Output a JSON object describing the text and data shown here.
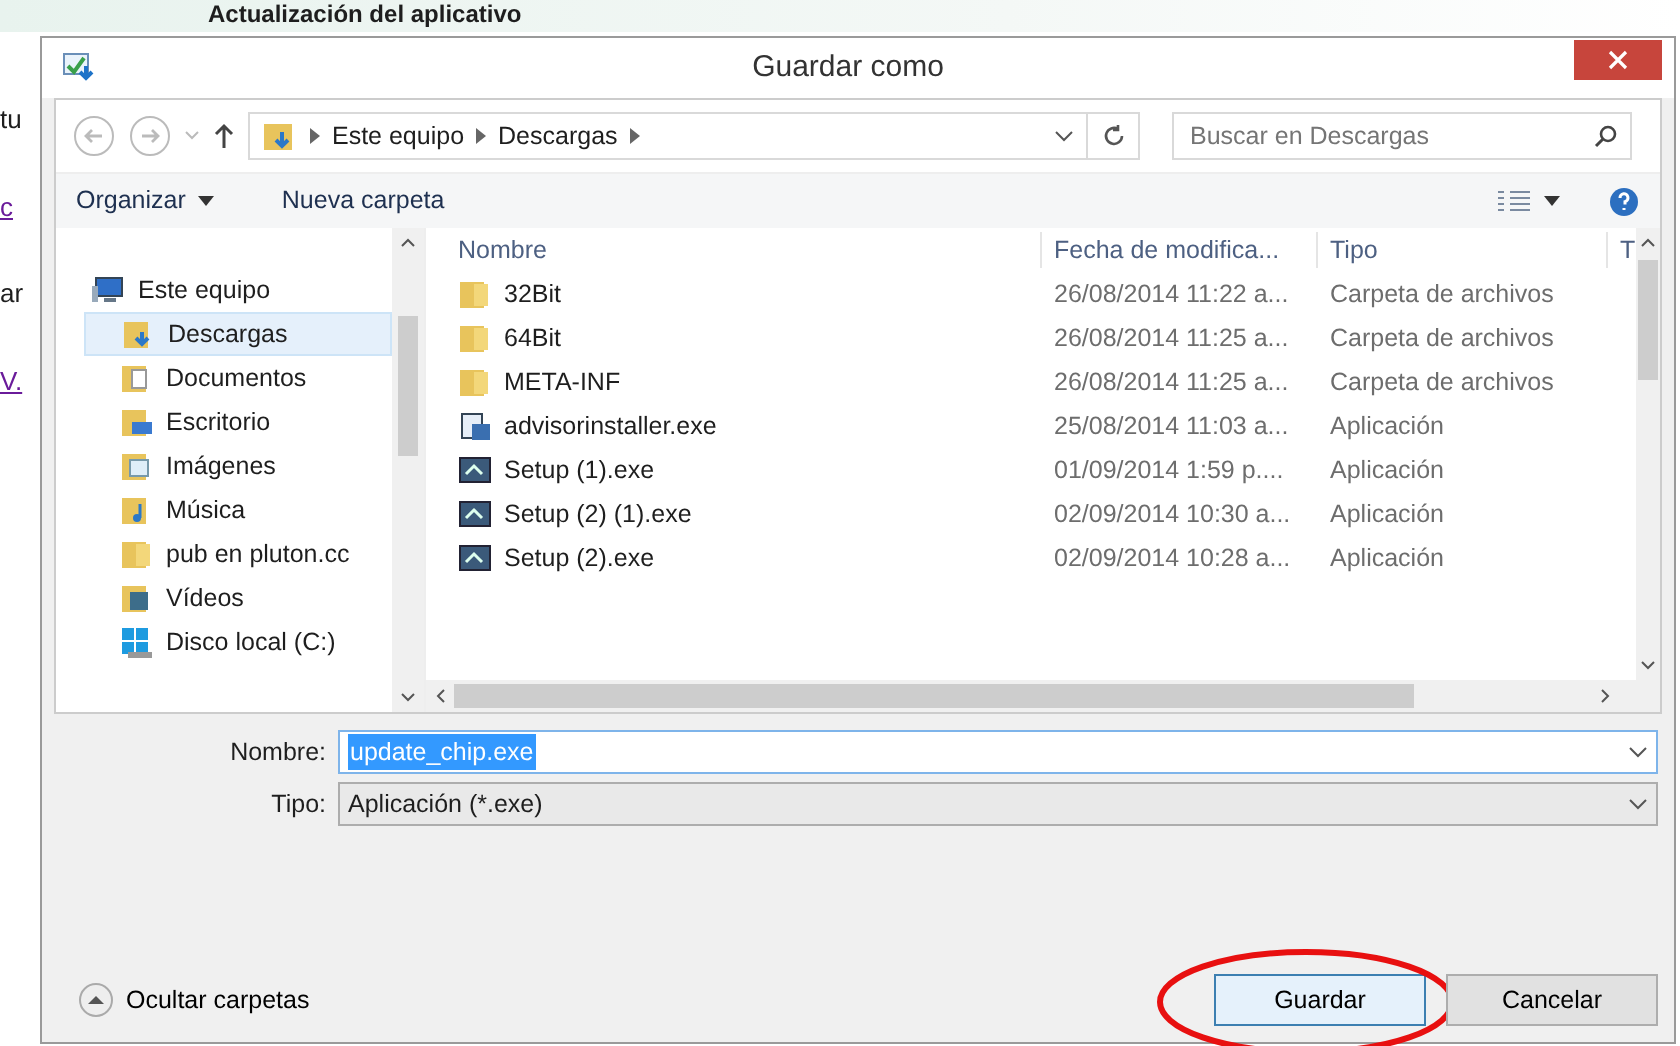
{
  "background": {
    "heading": "Actualización del aplicativo",
    "fragments": [
      {
        "text": "tu",
        "kind": "text"
      },
      {
        "text": "c",
        "kind": "link"
      },
      {
        "text": "ar",
        "kind": "text"
      },
      {
        "text": "V.",
        "kind": "link"
      }
    ]
  },
  "window": {
    "title": "Guardar como"
  },
  "address": {
    "crumbs": [
      "Este equipo",
      "Descargas"
    ]
  },
  "search": {
    "placeholder": "Buscar en Descargas"
  },
  "toolbar": {
    "organize": "Organizar",
    "new_folder": "Nueva carpeta"
  },
  "sidebar": {
    "items": [
      {
        "label": "Este equipo",
        "kind": "computer",
        "selected": false,
        "children": [
          {
            "label": "Descargas",
            "kind": "downloads",
            "selected": true
          },
          {
            "label": "Documentos",
            "kind": "documents",
            "selected": false
          },
          {
            "label": "Escritorio",
            "kind": "desktop",
            "selected": false
          },
          {
            "label": "Imágenes",
            "kind": "pictures",
            "selected": false
          },
          {
            "label": "Música",
            "kind": "music",
            "selected": false
          },
          {
            "label": "pub en pluton.cc",
            "kind": "folder",
            "selected": false
          },
          {
            "label": "Vídeos",
            "kind": "videos",
            "selected": false
          },
          {
            "label": "Disco local (C:)",
            "kind": "drive",
            "selected": false
          }
        ]
      }
    ]
  },
  "table": {
    "columns": [
      "Nombre",
      "Fecha de modifica...",
      "Tipo",
      "T"
    ],
    "rows": [
      {
        "name": "32Bit",
        "date": "26/08/2014 11:22 a...",
        "type": "Carpeta de archivos",
        "kind": "folder"
      },
      {
        "name": "64Bit",
        "date": "26/08/2014 11:25 a...",
        "type": "Carpeta de archivos",
        "kind": "folder"
      },
      {
        "name": "META-INF",
        "date": "26/08/2014 11:25 a...",
        "type": "Carpeta de archivos",
        "kind": "folder"
      },
      {
        "name": "advisorinstaller.exe",
        "date": "25/08/2014 11:03 a...",
        "type": "Aplicación",
        "kind": "installer"
      },
      {
        "name": "Setup (1).exe",
        "date": "01/09/2014 1:59 p....",
        "type": "Aplicación",
        "kind": "exe"
      },
      {
        "name": "Setup (2) (1).exe",
        "date": "02/09/2014 10:30 a...",
        "type": "Aplicación",
        "kind": "exe"
      },
      {
        "name": "Setup (2).exe",
        "date": "02/09/2014 10:28 a...",
        "type": "Aplicación",
        "kind": "exe"
      }
    ]
  },
  "form": {
    "name_label": "Nombre:",
    "name_value": "update_chip.exe",
    "type_label": "Tipo:",
    "type_value": "Aplicación (*.exe)"
  },
  "footer": {
    "hide_folders": "Ocultar carpetas",
    "buttons": [
      {
        "label": "Guardar",
        "default": true,
        "highlighted": true
      },
      {
        "label": "Cancelar",
        "default": false,
        "highlighted": false
      }
    ]
  }
}
